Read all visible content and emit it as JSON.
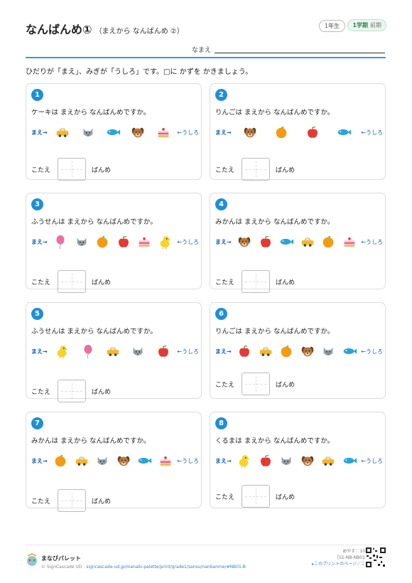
{
  "title": "なんばんめ①",
  "subtitle": "（まえから なんばんめ ②）",
  "grade": "1年生",
  "term": {
    "main": "1学期",
    "sub": "前期"
  },
  "name_label": "なまえ",
  "instruction": "ひだりが「まえ」、みぎが「うしろ」です。□に かずを かきましょう。",
  "front_label": "まえ→",
  "back_label": "←うしろ",
  "answer_label": "こたえ",
  "answer_suffix": "ばんめ",
  "questions": [
    {
      "num": "1",
      "text": "ケーキは まえから なんばんめですか。",
      "items": [
        "car-icon",
        "cat-icon",
        "fish-icon",
        "dog-icon",
        "cake-icon"
      ]
    },
    {
      "num": "2",
      "text": "りんごは まえから なんばんめですか。",
      "items": [
        "dog-icon",
        "orange-icon",
        "apple-icon",
        "fish-icon"
      ]
    },
    {
      "num": "3",
      "text": "ふうせんは まえから なんばんめですか。",
      "items": [
        "balloon-icon",
        "cat-icon",
        "orange-icon",
        "apple-icon",
        "cake-icon",
        "chick-icon"
      ]
    },
    {
      "num": "4",
      "text": "みかんは まえから なんばんめですか。",
      "items": [
        "dog-icon",
        "apple-icon",
        "fish-icon",
        "car-icon",
        "orange-icon",
        "cake-icon"
      ]
    },
    {
      "num": "5",
      "text": "ふうせんは まえから なんばんめですか。",
      "items": [
        "chick-icon",
        "balloon-icon",
        "car-icon",
        "cat-icon",
        "apple-icon"
      ]
    },
    {
      "num": "6",
      "text": "りんごは まえから なんばんめですか。",
      "items": [
        "apple-icon",
        "car-icon",
        "orange-icon",
        "dog-icon",
        "cat-icon",
        "fish-icon"
      ]
    },
    {
      "num": "7",
      "text": "みかんは まえから なんばんめですか。",
      "items": [
        "orange-icon",
        "car-icon",
        "cat-icon",
        "dog-icon",
        "fish-icon",
        "cake-icon"
      ]
    },
    {
      "num": "8",
      "text": "くるまは まえから なんばんめですか。",
      "items": [
        "chick-icon",
        "apple-icon",
        "cat-icon",
        "dog-icon",
        "car-icon",
        "fish-icon"
      ]
    }
  ],
  "footer": {
    "brand": "まなびパレット",
    "copyright": "© SignCascade UD",
    "url": "signcascade-ud.jp/manabi-palette/print/grade1/sansu/nanbanme/#NB01-B",
    "time": "めやす：10ぷん",
    "code": "［S1-NB-NB01-B］",
    "link": "▸このプリントのページ／こたえ"
  }
}
